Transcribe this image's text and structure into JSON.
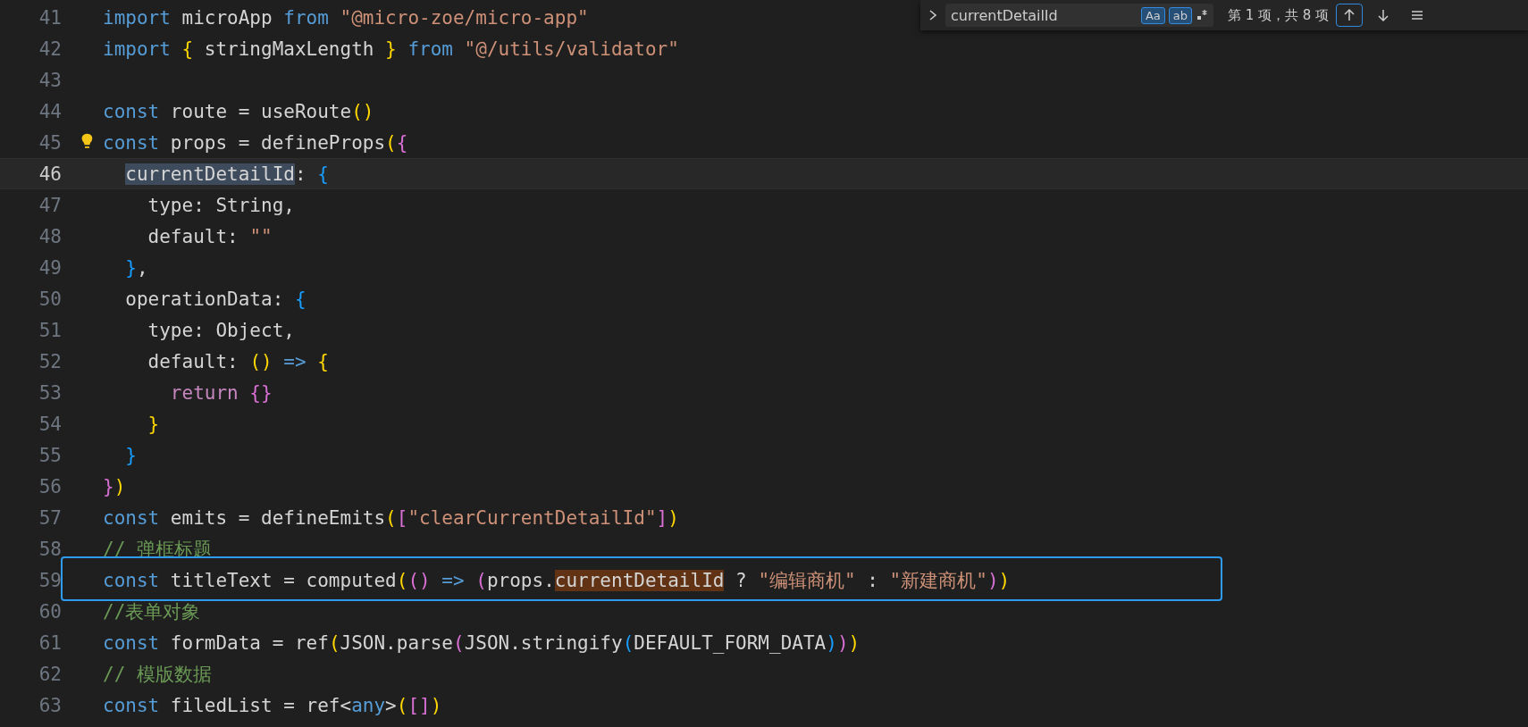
{
  "editor": {
    "lines": [
      {
        "number": "41",
        "current": false,
        "tokens": [
          {
            "kind": "keyword",
            "text": "import"
          },
          {
            "kind": "plain",
            "text": " microApp "
          },
          {
            "kind": "keyword",
            "text": "from"
          },
          {
            "kind": "string",
            "text": " \"@micro-zoe/micro-app\""
          }
        ]
      },
      {
        "number": "42",
        "current": false,
        "tokens": [
          {
            "kind": "keyword",
            "text": "import"
          },
          {
            "kind": "bracket1",
            "text": " {"
          },
          {
            "kind": "plain",
            "text": " stringMaxLength "
          },
          {
            "kind": "bracket1",
            "text": "}"
          },
          {
            "kind": "keyword",
            "text": " from"
          },
          {
            "kind": "string",
            "text": " \"@/utils/validator\""
          }
        ]
      },
      {
        "number": "43",
        "current": false
      },
      {
        "number": "44",
        "current": false,
        "tokens": [
          {
            "kind": "keyword",
            "text": "const"
          },
          {
            "kind": "plain",
            "text": " route = useRoute"
          },
          {
            "kind": "bracket1",
            "text": "()"
          }
        ]
      },
      {
        "number": "45",
        "current": false,
        "lightbulb": true,
        "tokens": [
          {
            "kind": "keyword",
            "text": "const"
          },
          {
            "kind": "plain",
            "text": " props = defineProps"
          },
          {
            "kind": "bracket1",
            "text": "("
          },
          {
            "kind": "bracket2",
            "text": "{"
          }
        ]
      },
      {
        "number": "46",
        "current": true,
        "tokens": [
          {
            "kind": "selection",
            "text": "  currentDetailId"
          },
          {
            "kind": "plain",
            "text": ": "
          },
          {
            "kind": "bracket3",
            "text": "{"
          }
        ]
      },
      {
        "number": "47",
        "current": false,
        "tokens": [
          {
            "kind": "plain",
            "text": "    type: String,"
          }
        ]
      },
      {
        "number": "48",
        "current": false,
        "tokens": [
          {
            "kind": "plain",
            "text": "    default: "
          },
          {
            "kind": "string",
            "text": "\"\""
          }
        ]
      },
      {
        "number": "49",
        "current": false,
        "tokens": [
          {
            "kind": "bracket3",
            "text": "  }"
          },
          {
            "kind": "plain",
            "text": ","
          }
        ]
      },
      {
        "number": "50",
        "current": false,
        "tokens": [
          {
            "kind": "plain",
            "text": "  operationData: "
          },
          {
            "kind": "bracket3",
            "text": "{"
          }
        ]
      },
      {
        "number": "51",
        "current": false,
        "tokens": [
          {
            "kind": "plain",
            "text": "    type: Object,"
          }
        ]
      },
      {
        "number": "52",
        "current": false,
        "tokens": [
          {
            "kind": "plain",
            "text": "    default: "
          },
          {
            "kind": "bracket1",
            "text": "()"
          },
          {
            "kind": "keyword",
            "text": " => "
          },
          {
            "kind": "bracket1",
            "text": "{"
          }
        ]
      },
      {
        "number": "53",
        "current": false,
        "tokens": [
          {
            "kind": "control",
            "text": "      return"
          },
          {
            "kind": "bracket2",
            "text": " {}"
          }
        ]
      },
      {
        "number": "54",
        "current": false,
        "tokens": [
          {
            "kind": "bracket1",
            "text": "    }"
          }
        ]
      },
      {
        "number": "55",
        "current": false,
        "tokens": [
          {
            "kind": "bracket3",
            "text": "  }"
          }
        ]
      },
      {
        "number": "56",
        "current": false,
        "tokens": [
          {
            "kind": "bracket2",
            "text": "}"
          },
          {
            "kind": "bracket1",
            "text": ")"
          }
        ]
      },
      {
        "number": "57",
        "current": false,
        "tokens": [
          {
            "kind": "keyword",
            "text": "const"
          },
          {
            "kind": "plain",
            "text": " emits = defineEmits"
          },
          {
            "kind": "bracket1",
            "text": "("
          },
          {
            "kind": "bracket2",
            "text": "["
          },
          {
            "kind": "string",
            "text": "\"clearCurrentDetailId\""
          },
          {
            "kind": "bracket2",
            "text": "]"
          },
          {
            "kind": "bracket1",
            "text": ")"
          }
        ]
      },
      {
        "number": "58",
        "current": false,
        "tokens": [
          {
            "kind": "comment",
            "text": "// 弹框标题"
          }
        ]
      },
      {
        "number": "59",
        "current": false,
        "boxed": true,
        "tokens": [
          {
            "kind": "keyword",
            "text": "const"
          },
          {
            "kind": "plain",
            "text": " titleText = computed"
          },
          {
            "kind": "bracket1",
            "text": "("
          },
          {
            "kind": "bracket2",
            "text": "()"
          },
          {
            "kind": "keyword",
            "text": " => "
          },
          {
            "kind": "bracket2",
            "text": "("
          },
          {
            "kind": "plain",
            "text": "props."
          },
          {
            "kind": "match",
            "text": "currentDetailId"
          },
          {
            "kind": "plain",
            "text": " ? "
          },
          {
            "kind": "string",
            "text": "\"编辑商机\""
          },
          {
            "kind": "plain",
            "text": " : "
          },
          {
            "kind": "string",
            "text": "\"新建商机\""
          },
          {
            "kind": "bracket2",
            "text": ")"
          },
          {
            "kind": "bracket1",
            "text": ")"
          }
        ]
      },
      {
        "number": "60",
        "current": false,
        "tokens": [
          {
            "kind": "comment",
            "text": "//表单对象"
          }
        ]
      },
      {
        "number": "61",
        "current": false,
        "tokens": [
          {
            "kind": "keyword",
            "text": "const"
          },
          {
            "kind": "plain",
            "text": " formData = ref"
          },
          {
            "kind": "bracket1",
            "text": "("
          },
          {
            "kind": "plain",
            "text": "JSON.parse"
          },
          {
            "kind": "bracket2",
            "text": "("
          },
          {
            "kind": "plain",
            "text": "JSON.stringify"
          },
          {
            "kind": "bracket3",
            "text": "("
          },
          {
            "kind": "plain",
            "text": "DEFAULT_FORM_DATA"
          },
          {
            "kind": "bracket3",
            "text": ")"
          },
          {
            "kind": "bracket2",
            "text": ")"
          },
          {
            "kind": "bracket1",
            "text": ")"
          }
        ]
      },
      {
        "number": "62",
        "current": false,
        "tokens": [
          {
            "kind": "comment",
            "text": "// 模版数据"
          }
        ]
      },
      {
        "number": "63",
        "current": false,
        "tokens": [
          {
            "kind": "keyword",
            "text": "const"
          },
          {
            "kind": "plain",
            "text": " filedList = ref<"
          },
          {
            "kind": "keyword",
            "text": "any"
          },
          {
            "kind": "plain",
            "text": ">"
          },
          {
            "kind": "bracket1",
            "text": "("
          },
          {
            "kind": "bracket2",
            "text": "[]"
          },
          {
            "kind": "bracket1",
            "text": ")"
          }
        ]
      }
    ]
  },
  "find_widget": {
    "query": "currentDetailId",
    "toggles": [
      {
        "label": "Aa",
        "selected": true
      },
      {
        "label": "ab",
        "selected": true
      }
    ],
    "count": "第 1 项，共 8 项"
  }
}
